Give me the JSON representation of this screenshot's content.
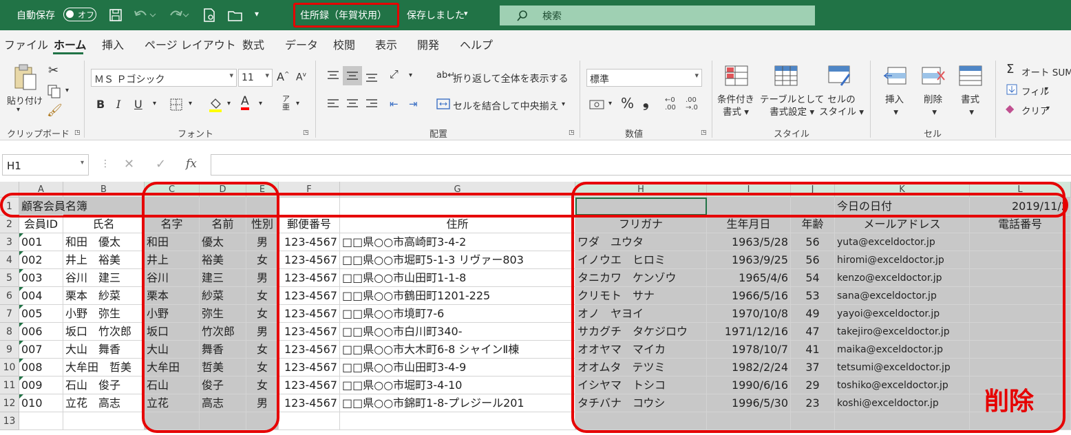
{
  "titlebar": {
    "autosave_label": "自動保存",
    "autosave_state": "オフ",
    "filename": "住所録（年賀状用）",
    "save_status": "保存しました",
    "search_placeholder": "検索"
  },
  "menu": {
    "tabs": [
      "ファイル",
      "ホーム",
      "挿入",
      "ページ レイアウト",
      "数式",
      "データ",
      "校閲",
      "表示",
      "開発",
      "ヘルプ"
    ],
    "active": "ホーム"
  },
  "ribbon": {
    "clipboard": {
      "paste": "貼り付け",
      "group": "クリップボード"
    },
    "font": {
      "name": "ＭＳ Ｐゴシック",
      "size": "11",
      "group": "フォント",
      "bold": "B",
      "italic": "I",
      "underline": "U"
    },
    "alignment": {
      "wrap": "折り返して全体を表示する",
      "merge": "セルを結合して中央揃え",
      "group": "配置"
    },
    "number": {
      "format": "標準",
      "group": "数値",
      "percent": "%",
      "comma": "❟"
    },
    "styles": {
      "conditional": [
        "条件付き",
        "書式"
      ],
      "table": [
        "テーブルとして",
        "書式設定"
      ],
      "cell": [
        "セルの",
        "スタイル"
      ],
      "group": "スタイル"
    },
    "cells": {
      "insert": "挿入",
      "delete": "削除",
      "format": "書式",
      "group": "セル"
    },
    "editing": {
      "autosum": "オート SUM",
      "fill": "フィル",
      "clear": "クリア"
    }
  },
  "formula_bar": {
    "namebox": "H1",
    "fx": "fx",
    "value": ""
  },
  "columns": [
    "A",
    "B",
    "C",
    "D",
    "E",
    "F",
    "G",
    "H",
    "I",
    "J",
    "K",
    "L"
  ],
  "row_numbers": [
    "1",
    "2",
    "3",
    "4",
    "5",
    "6",
    "7",
    "8",
    "9",
    "10",
    "11",
    "12",
    "13"
  ],
  "row1": {
    "title": "顧客会員名簿",
    "today_label": "今日の日付",
    "today_value": "2019/11/2"
  },
  "headers": [
    "会員ID",
    "氏名",
    "名字",
    "名前",
    "性別",
    "郵便番号",
    "住所",
    "フリガナ",
    "生年月日",
    "年齢",
    "メールアドレス",
    "電話番号"
  ],
  "rows": [
    [
      "001",
      "和田　優太",
      "和田",
      "優太",
      "男",
      "123-4567",
      "□□県○○市高崎町3-4-2",
      "ワダ　ユウタ",
      "1963/5/28",
      "56",
      "yuta@exceldoctor.jp",
      ""
    ],
    [
      "002",
      "井上　裕美",
      "井上",
      "裕美",
      "女",
      "123-4567",
      "□□県○○市堀町5-1-3  リヴァー803",
      "イノウエ　ヒロミ",
      "1963/9/25",
      "56",
      "hiromi@exceldoctor.jp",
      ""
    ],
    [
      "003",
      "谷川　建三",
      "谷川",
      "建三",
      "男",
      "123-4567",
      "□□県○○市山田町1-1-8",
      "タニカワ　ケンゾウ",
      "1965/4/6",
      "54",
      "kenzo@exceldoctor.jp",
      ""
    ],
    [
      "004",
      "栗本　紗菜",
      "栗本",
      "紗菜",
      "女",
      "123-4567",
      "□□県○○市鶴田町1201-225",
      "クリモト　サナ",
      "1966/5/16",
      "53",
      "sana@exceldoctor.jp",
      ""
    ],
    [
      "005",
      "小野　弥生",
      "小野",
      "弥生",
      "女",
      "123-4567",
      "□□県○○市境町7-6",
      "オノ　ヤヨイ",
      "1970/10/8",
      "49",
      "yayoi@exceldoctor.jp",
      ""
    ],
    [
      "006",
      "坂口　竹次郎",
      "坂口",
      "竹次郎",
      "男",
      "123-4567",
      "□□県○○市白川町340-",
      "サカグチ　タケジロウ",
      "1971/12/16",
      "47",
      "takejiro@exceldoctor.jp",
      ""
    ],
    [
      "007",
      "大山　舞香",
      "大山",
      "舞香",
      "女",
      "123-4567",
      "□□県○○市大木町6-8  シャインⅡ棟",
      "オオヤマ　マイカ",
      "1978/10/7",
      "41",
      "maika@exceldoctor.jp",
      ""
    ],
    [
      "008",
      "大牟田　哲美",
      "大牟田",
      "哲美",
      "女",
      "123-4567",
      "□□県○○市山田町3-4-9",
      "オオムタ　テツミ",
      "1982/2/24",
      "37",
      "tetsumi@exceldoctor.jp",
      ""
    ],
    [
      "009",
      "石山　俊子",
      "石山",
      "俊子",
      "女",
      "123-4567",
      "□□県○○市堀町3-4-10",
      "イシヤマ　トシコ",
      "1990/6/16",
      "29",
      "toshiko@exceldoctor.jp",
      ""
    ],
    [
      "010",
      "立花　高志",
      "立花",
      "高志",
      "男",
      "123-4567",
      "□□県○○市錦町1-8-プレジール201",
      "タチバナ　コウシ",
      "1996/5/30",
      "23",
      "koshi@exceldoctor.jp",
      ""
    ]
  ],
  "annotation": {
    "delete_label": "削除",
    "color": "#e60000"
  },
  "colors": {
    "excel_green": "#217346",
    "selection_gray": "#c8c8c8"
  }
}
